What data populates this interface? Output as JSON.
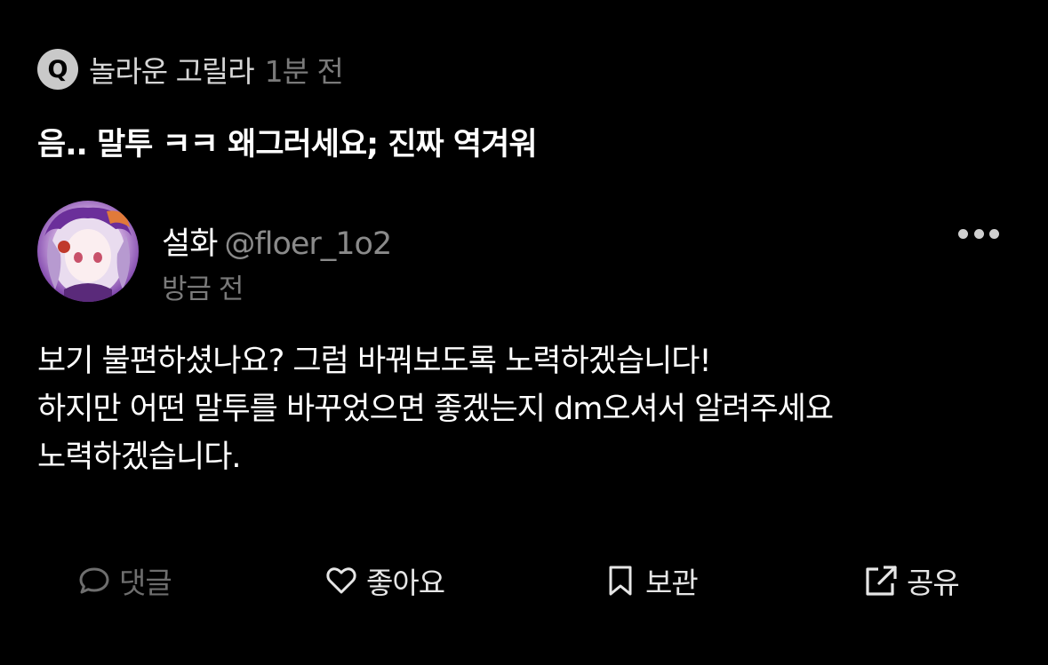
{
  "question": {
    "badge": "Q",
    "author": "놀라운 고릴라",
    "time": "1분 전",
    "text": "음.. 말투 ㅋㅋ 왜그러세요; 진짜 역겨워"
  },
  "reply": {
    "name": "설화",
    "handle": "@floer_1o2",
    "time": "방금 전",
    "lines": [
      "보기 불편하셨나요? 그럼 바꿔보도록 노력하겠습니다!",
      "하지만 어떤 말투를 바꾸었으면 좋겠는지 dm오셔서 알려주세요",
      "노력하겠습니다."
    ]
  },
  "actions": {
    "comment": "댓글",
    "like": "좋아요",
    "save": "보관",
    "share": "공유"
  },
  "icons": {
    "more": "more-horizontal-icon",
    "comment": "chat-bubble-icon",
    "like": "heart-icon",
    "save": "bookmark-icon",
    "share": "share-external-icon"
  },
  "colors": {
    "background": "#000000",
    "text": "#ffffff",
    "muted": "#7a7a7a",
    "disabled": "#6e6e6e"
  }
}
